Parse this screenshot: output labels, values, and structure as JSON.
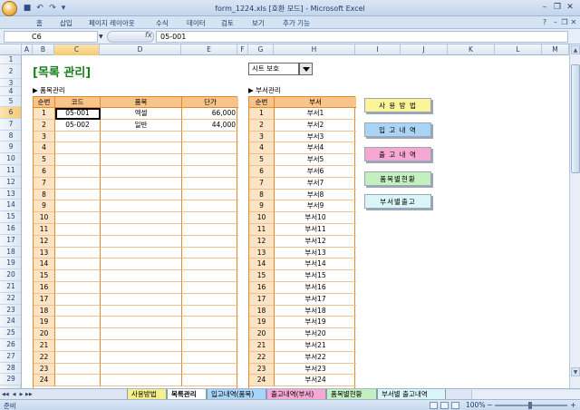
{
  "window": {
    "title": "form_1224.xls  [호환 모드]  - Microsoft Excel"
  },
  "ribbon_tabs": [
    "홈",
    "삽입",
    "페이지 레이아웃",
    "수식",
    "데이터",
    "검토",
    "보기",
    "추가 기능"
  ],
  "formula_bar": {
    "name_box": "C6",
    "fx": "fx",
    "formula": "05-001"
  },
  "columns": [
    "A",
    "B",
    "C",
    "D",
    "E",
    "F",
    "G",
    "H",
    "I",
    "J",
    "K",
    "L",
    "M"
  ],
  "selected_column": "C",
  "rows": [
    "1",
    "2",
    "3",
    "4",
    "5",
    "6",
    "7",
    "8",
    "9",
    "10",
    "11",
    "12",
    "13",
    "14",
    "15",
    "16",
    "17",
    "18",
    "19",
    "20",
    "21",
    "22",
    "23",
    "24",
    "25",
    "26",
    "27",
    "28",
    "29"
  ],
  "selected_row": "6",
  "sheet": {
    "title": "[목록 관리]",
    "protect_select": "시트 보호",
    "item_section_label": "▶ 품목관리",
    "dept_section_label": "▶ 부서관리",
    "item_table": {
      "headers": [
        "순번",
        "코드",
        "품목",
        "단가"
      ],
      "rows": [
        [
          "1",
          "05-001",
          "엑셀",
          "66,000"
        ],
        [
          "2",
          "05-002",
          "일반",
          "44,000"
        ],
        [
          "3",
          "",
          "",
          ""
        ],
        [
          "4",
          "",
          "",
          ""
        ],
        [
          "5",
          "",
          "",
          ""
        ],
        [
          "6",
          "",
          "",
          ""
        ],
        [
          "7",
          "",
          "",
          ""
        ],
        [
          "8",
          "",
          "",
          ""
        ],
        [
          "9",
          "",
          "",
          ""
        ],
        [
          "10",
          "",
          "",
          ""
        ],
        [
          "11",
          "",
          "",
          ""
        ],
        [
          "12",
          "",
          "",
          ""
        ],
        [
          "13",
          "",
          "",
          ""
        ],
        [
          "14",
          "",
          "",
          ""
        ],
        [
          "15",
          "",
          "",
          ""
        ],
        [
          "16",
          "",
          "",
          ""
        ],
        [
          "17",
          "",
          "",
          ""
        ],
        [
          "18",
          "",
          "",
          ""
        ],
        [
          "19",
          "",
          "",
          ""
        ],
        [
          "20",
          "",
          "",
          ""
        ],
        [
          "21",
          "",
          "",
          ""
        ],
        [
          "22",
          "",
          "",
          ""
        ],
        [
          "23",
          "",
          "",
          ""
        ],
        [
          "24",
          "",
          "",
          ""
        ]
      ]
    },
    "dept_table": {
      "headers": [
        "순번",
        "부서"
      ],
      "rows": [
        [
          "1",
          "부서1"
        ],
        [
          "2",
          "부서2"
        ],
        [
          "3",
          "부서3"
        ],
        [
          "4",
          "부서4"
        ],
        [
          "5",
          "부서5"
        ],
        [
          "6",
          "부서6"
        ],
        [
          "7",
          "부서7"
        ],
        [
          "8",
          "부서8"
        ],
        [
          "9",
          "부서9"
        ],
        [
          "10",
          "부서10"
        ],
        [
          "11",
          "부서11"
        ],
        [
          "12",
          "부서12"
        ],
        [
          "13",
          "부서13"
        ],
        [
          "14",
          "부서14"
        ],
        [
          "15",
          "부서15"
        ],
        [
          "16",
          "부서16"
        ],
        [
          "17",
          "부서17"
        ],
        [
          "18",
          "부서18"
        ],
        [
          "19",
          "부서19"
        ],
        [
          "20",
          "부서20"
        ],
        [
          "21",
          "부서21"
        ],
        [
          "22",
          "부서22"
        ],
        [
          "23",
          "부서23"
        ],
        [
          "24",
          "부서24"
        ]
      ]
    },
    "buttons": [
      {
        "label": "사 용 방 법",
        "color": "#fdf49a"
      },
      {
        "label": "입 고 내 역",
        "color": "#a9d4f5"
      },
      {
        "label": "출 고 내 역",
        "color": "#f7a8d2"
      },
      {
        "label": "품목별현황",
        "color": "#c4f0c0"
      },
      {
        "label": "부서별출고",
        "color": "#d9f5f8"
      }
    ]
  },
  "sheet_tabs": [
    "사용방법",
    "목록관리",
    "입고내역(품목)",
    "출고내역(부서)",
    "품목별현황",
    "부서별 출고내역"
  ],
  "sheet_tab_colors": [
    "#f7f08a",
    "#ffffff",
    "#a9d4f5",
    "#f7a8d2",
    "#c4f0c0",
    "#d9f5f8"
  ],
  "active_sheet_tab": "목록관리",
  "status": {
    "ready": "준비",
    "zoom": "100%"
  }
}
